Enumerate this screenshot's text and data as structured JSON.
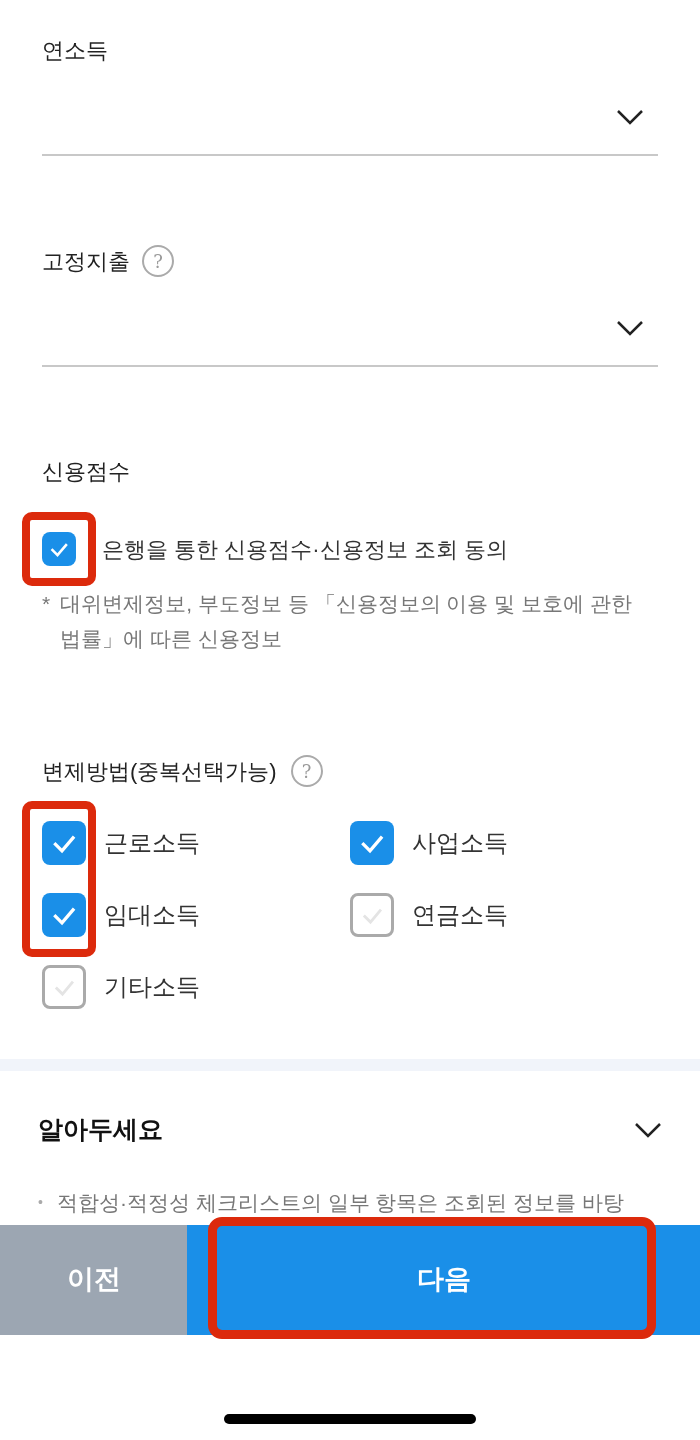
{
  "fields": [
    {
      "label": "연소득"
    },
    {
      "label": "고정지출",
      "help": "?"
    }
  ],
  "credit": {
    "title": "신용점수",
    "consent": {
      "label": "은행을 통한 신용점수·신용정보 조회 동의",
      "checked": true,
      "highlighted": true
    },
    "note_mark": "*",
    "note": "대위변제정보, 부도정보 등 「신용정보의 이용 및 보호에 관한 법률」에 따른 신용정보"
  },
  "repayment": {
    "title": "변제방법(중복선택가능)",
    "help": "?",
    "options": [
      {
        "label": "근로소득",
        "checked": true,
        "highlighted": true
      },
      {
        "label": "사업소득",
        "checked": true,
        "highlighted": false
      },
      {
        "label": "임대소득",
        "checked": true,
        "highlighted": true
      },
      {
        "label": "연금소득",
        "checked": false,
        "highlighted": false
      },
      {
        "label": "기타소득",
        "checked": false,
        "highlighted": false
      }
    ]
  },
  "notice": {
    "title": "알아두세요",
    "expanded": false,
    "bullet": "•",
    "text": "적합성·적정성 체크리스트의 일부 항목은 조회된 정보를 바탕"
  },
  "buttons": {
    "prev": {
      "label": "이전"
    },
    "next": {
      "label": "다음",
      "highlighted": true
    }
  }
}
